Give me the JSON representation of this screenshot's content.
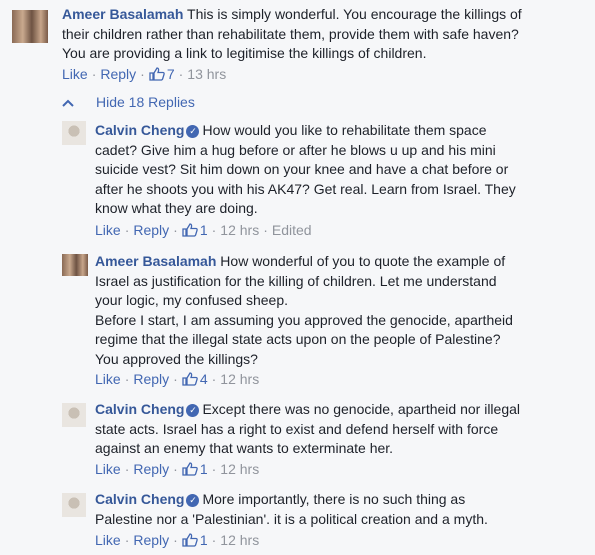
{
  "comments": [
    {
      "author": "Ameer Basalamah",
      "verified": false,
      "text": "This is simply wonderful. You encourage the killings of\ntheir children rather than rehabilitate them, provide them with safe haven?\nYou are providing a link to legitimise the killings of children.",
      "like": "Like",
      "reply": "Reply",
      "likes": "7",
      "time": "13 hrs",
      "edited": ""
    },
    {
      "author": "Calvin Cheng",
      "verified": true,
      "text": "How would you like to rehabilitate them space\ncadet? Give him a hug before or after he blows u up and his mini\nsuicide vest? Sit him down on your knee and have a chat before or\nafter he shoots you with his AK47? Get real. Learn from Israel. They\nknow what they are doing.",
      "like": "Like",
      "reply": "Reply",
      "likes": "1",
      "time": "12 hrs",
      "edited": "Edited"
    },
    {
      "author": "Ameer Basalamah",
      "verified": false,
      "text": "How wonderful of you to quote the example of\nIsrael as justification for the killing of children. Let me understand\nyour logic, my confused sheep.\nBefore I start, I am assuming you approved the genocide, apartheid\nregime that the illegal state acts upon on the people of Palestine?\nYou approved the killings?",
      "like": "Like",
      "reply": "Reply",
      "likes": "4",
      "time": "12 hrs",
      "edited": ""
    },
    {
      "author": "Calvin Cheng",
      "verified": true,
      "text": "Except there was no genocide, apartheid nor illegal\nstate acts. Israel has a right to exist and defend herself with force\nagainst an enemy that wants to exterminate her.",
      "like": "Like",
      "reply": "Reply",
      "likes": "1",
      "time": "12 hrs",
      "edited": ""
    },
    {
      "author": "Calvin Cheng",
      "verified": true,
      "text": "More importantly, there is no such thing as\nPalestine nor a 'Palestinian'. it is a political creation and a myth.",
      "like": "Like",
      "reply": "Reply",
      "likes": "1",
      "time": "12 hrs",
      "edited": ""
    }
  ],
  "replies_toggle": {
    "label": "Hide 18 Replies"
  },
  "icons": {
    "like": "thumbs-up-icon",
    "toggle": "chevron-up-icon",
    "verified": "verified-check-icon"
  },
  "colors": {
    "link": "#4267b2",
    "author": "#365899",
    "meta": "#90949c",
    "background": "#f6f7f9"
  }
}
